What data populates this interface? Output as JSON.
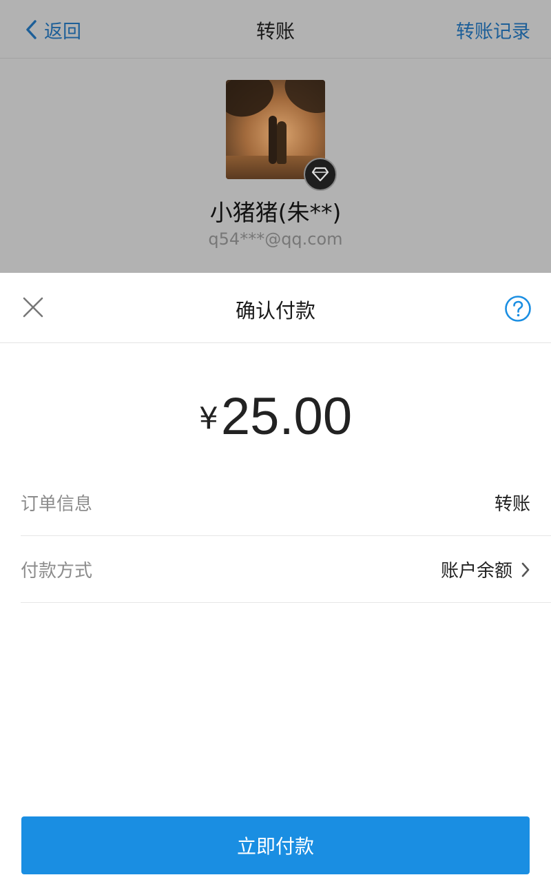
{
  "navbar": {
    "back_label": "返回",
    "title": "转账",
    "right_label": "转账记录"
  },
  "recipient": {
    "name": "小猪猪(朱**)",
    "account": "q54***@qq.com"
  },
  "sheet": {
    "title": "确认付款",
    "currency_symbol": "¥",
    "amount": "25.00",
    "rows": [
      {
        "label": "订单信息",
        "value": "转账"
      },
      {
        "label": "付款方式",
        "value": "账户余额"
      }
    ],
    "pay_button_label": "立即付款"
  },
  "colors": {
    "accent_blue": "#1a8ee2",
    "nav_link_blue": "#1d5f98",
    "overlay_gray": "#b2b2b2"
  },
  "icons": [
    "chevron-left-icon",
    "vip-diamond-icon",
    "close-icon",
    "help-icon",
    "chevron-right-icon"
  ]
}
